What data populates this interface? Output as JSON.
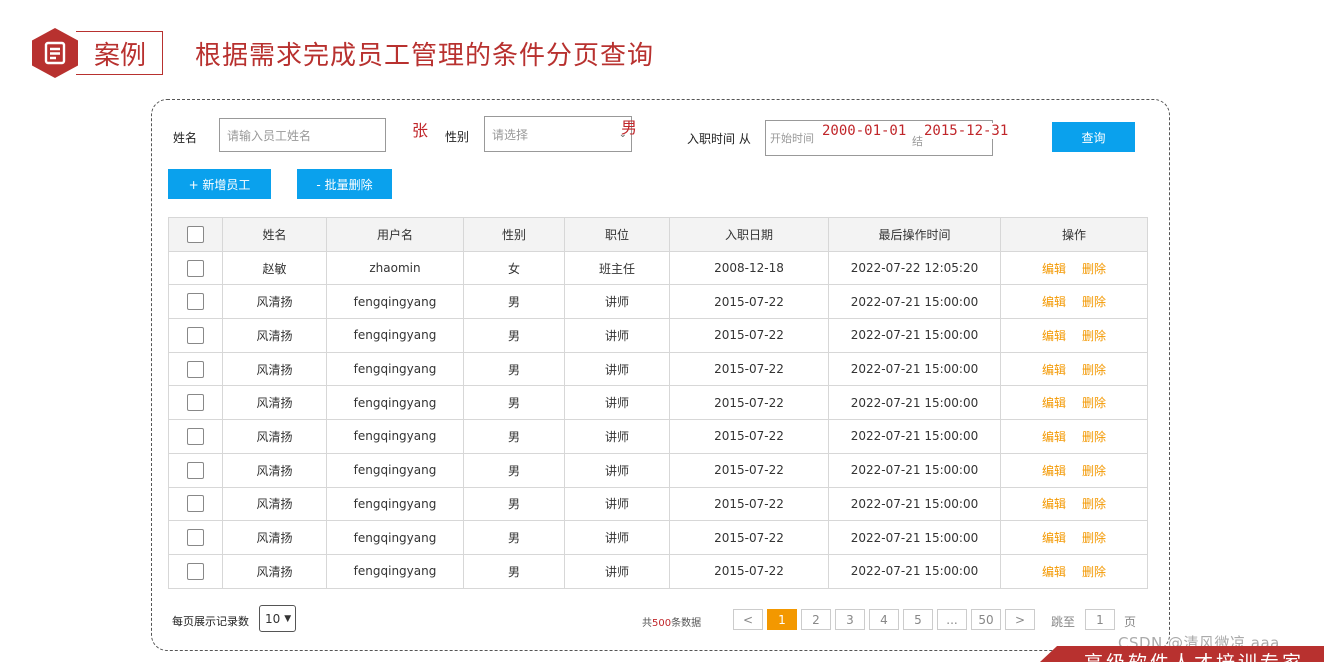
{
  "header": {
    "case_label": "案例",
    "title": "根据需求完成员工管理的条件分页查询"
  },
  "search": {
    "name_label": "姓名",
    "name_placeholder": "请输入员工姓名",
    "name_annotation": "张",
    "gender_label": "性别",
    "gender_placeholder": "请选择",
    "gender_annotation": "男",
    "date_label": "入职时间 从",
    "date_start_placeholder": "开始时间",
    "date_end_placeholder": "结",
    "date_start_annotation": "2000-01-01",
    "date_end_annotation": "2015-12-31",
    "query_button": "查询"
  },
  "actions": {
    "add_button": "+ 新增员工",
    "batch_delete_button": "- 批量删除"
  },
  "table": {
    "columns": [
      "姓名",
      "用户名",
      "性别",
      "职位",
      "入职日期",
      "最后操作时间",
      "操作"
    ],
    "edit_label": "编辑",
    "delete_label": "删除",
    "rows": [
      {
        "name": "赵敏",
        "username": "zhaomin",
        "gender": "女",
        "position": "班主任",
        "entry_date": "2008-12-18",
        "last_op": "2022-07-22 12:05:20"
      },
      {
        "name": "风清扬",
        "username": "fengqingyang",
        "gender": "男",
        "position": "讲师",
        "entry_date": "2015-07-22",
        "last_op": "2022-07-21 15:00:00"
      },
      {
        "name": "风清扬",
        "username": "fengqingyang",
        "gender": "男",
        "position": "讲师",
        "entry_date": "2015-07-22",
        "last_op": "2022-07-21 15:00:00"
      },
      {
        "name": "风清扬",
        "username": "fengqingyang",
        "gender": "男",
        "position": "讲师",
        "entry_date": "2015-07-22",
        "last_op": "2022-07-21 15:00:00"
      },
      {
        "name": "风清扬",
        "username": "fengqingyang",
        "gender": "男",
        "position": "讲师",
        "entry_date": "2015-07-22",
        "last_op": "2022-07-21 15:00:00"
      },
      {
        "name": "风清扬",
        "username": "fengqingyang",
        "gender": "男",
        "position": "讲师",
        "entry_date": "2015-07-22",
        "last_op": "2022-07-21 15:00:00"
      },
      {
        "name": "风清扬",
        "username": "fengqingyang",
        "gender": "男",
        "position": "讲师",
        "entry_date": "2015-07-22",
        "last_op": "2022-07-21 15:00:00"
      },
      {
        "name": "风清扬",
        "username": "fengqingyang",
        "gender": "男",
        "position": "讲师",
        "entry_date": "2015-07-22",
        "last_op": "2022-07-21 15:00:00"
      },
      {
        "name": "风清扬",
        "username": "fengqingyang",
        "gender": "男",
        "position": "讲师",
        "entry_date": "2015-07-22",
        "last_op": "2022-07-21 15:00:00"
      },
      {
        "name": "风清扬",
        "username": "fengqingyang",
        "gender": "男",
        "position": "讲师",
        "entry_date": "2015-07-22",
        "last_op": "2022-07-21 15:00:00"
      }
    ]
  },
  "pagination": {
    "page_size_label": "每页展示记录数",
    "page_size_value": "10",
    "total_prefix": "共",
    "total_count": "500",
    "total_suffix": "条数据",
    "prev": "<",
    "pages": [
      "1",
      "2",
      "3",
      "4",
      "5",
      "...",
      "50"
    ],
    "current_page": "1",
    "next": ">",
    "jump_label": "跳至",
    "jump_value": "1",
    "page_unit": "页"
  },
  "watermark": "CSDN @清风微凉 aaa",
  "footer_band_text": "高级软件人才培训专家",
  "colors": {
    "brand_red": "#b8312f",
    "primary_blue": "#0aa1ed",
    "accent_orange": "#f39800"
  }
}
